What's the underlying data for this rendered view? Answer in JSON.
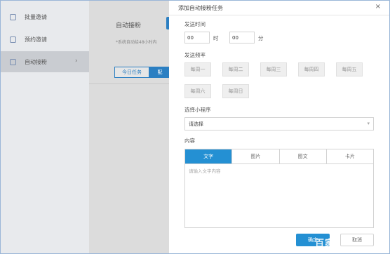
{
  "sidebar": {
    "items": [
      {
        "label": "批量邀请",
        "icon": "invite-icon"
      },
      {
        "label": "预约邀请",
        "icon": "calendar-icon"
      },
      {
        "label": "自动接粉",
        "icon": "contact-icon"
      }
    ]
  },
  "main": {
    "title": "自动接粉",
    "note": "*系统自动给48小时内",
    "tabs": [
      "今日任务",
      "配"
    ]
  },
  "modal": {
    "title": "添加自动接粉任务",
    "close": "×",
    "send_time_label": "发送时间",
    "hour_value": "00",
    "hour_unit": "时",
    "minute_value": "00",
    "minute_unit": "分",
    "frequency_label": "发送频率",
    "days": [
      "每周一",
      "每周二",
      "每周三",
      "每周四",
      "每周五",
      "每周六",
      "每周日"
    ],
    "miniprogram_label": "选择小程序",
    "miniprogram_placeholder": "请选择",
    "content_label": "内容",
    "content_tabs": [
      "文字",
      "图片",
      "图文",
      "卡片"
    ],
    "content_placeholder": "请输入文字内容",
    "confirm": "确定",
    "cancel": "取消"
  },
  "watermark": "百家",
  "colors": {
    "accent": "#2490d3",
    "overlay": "#d9d9d9"
  }
}
